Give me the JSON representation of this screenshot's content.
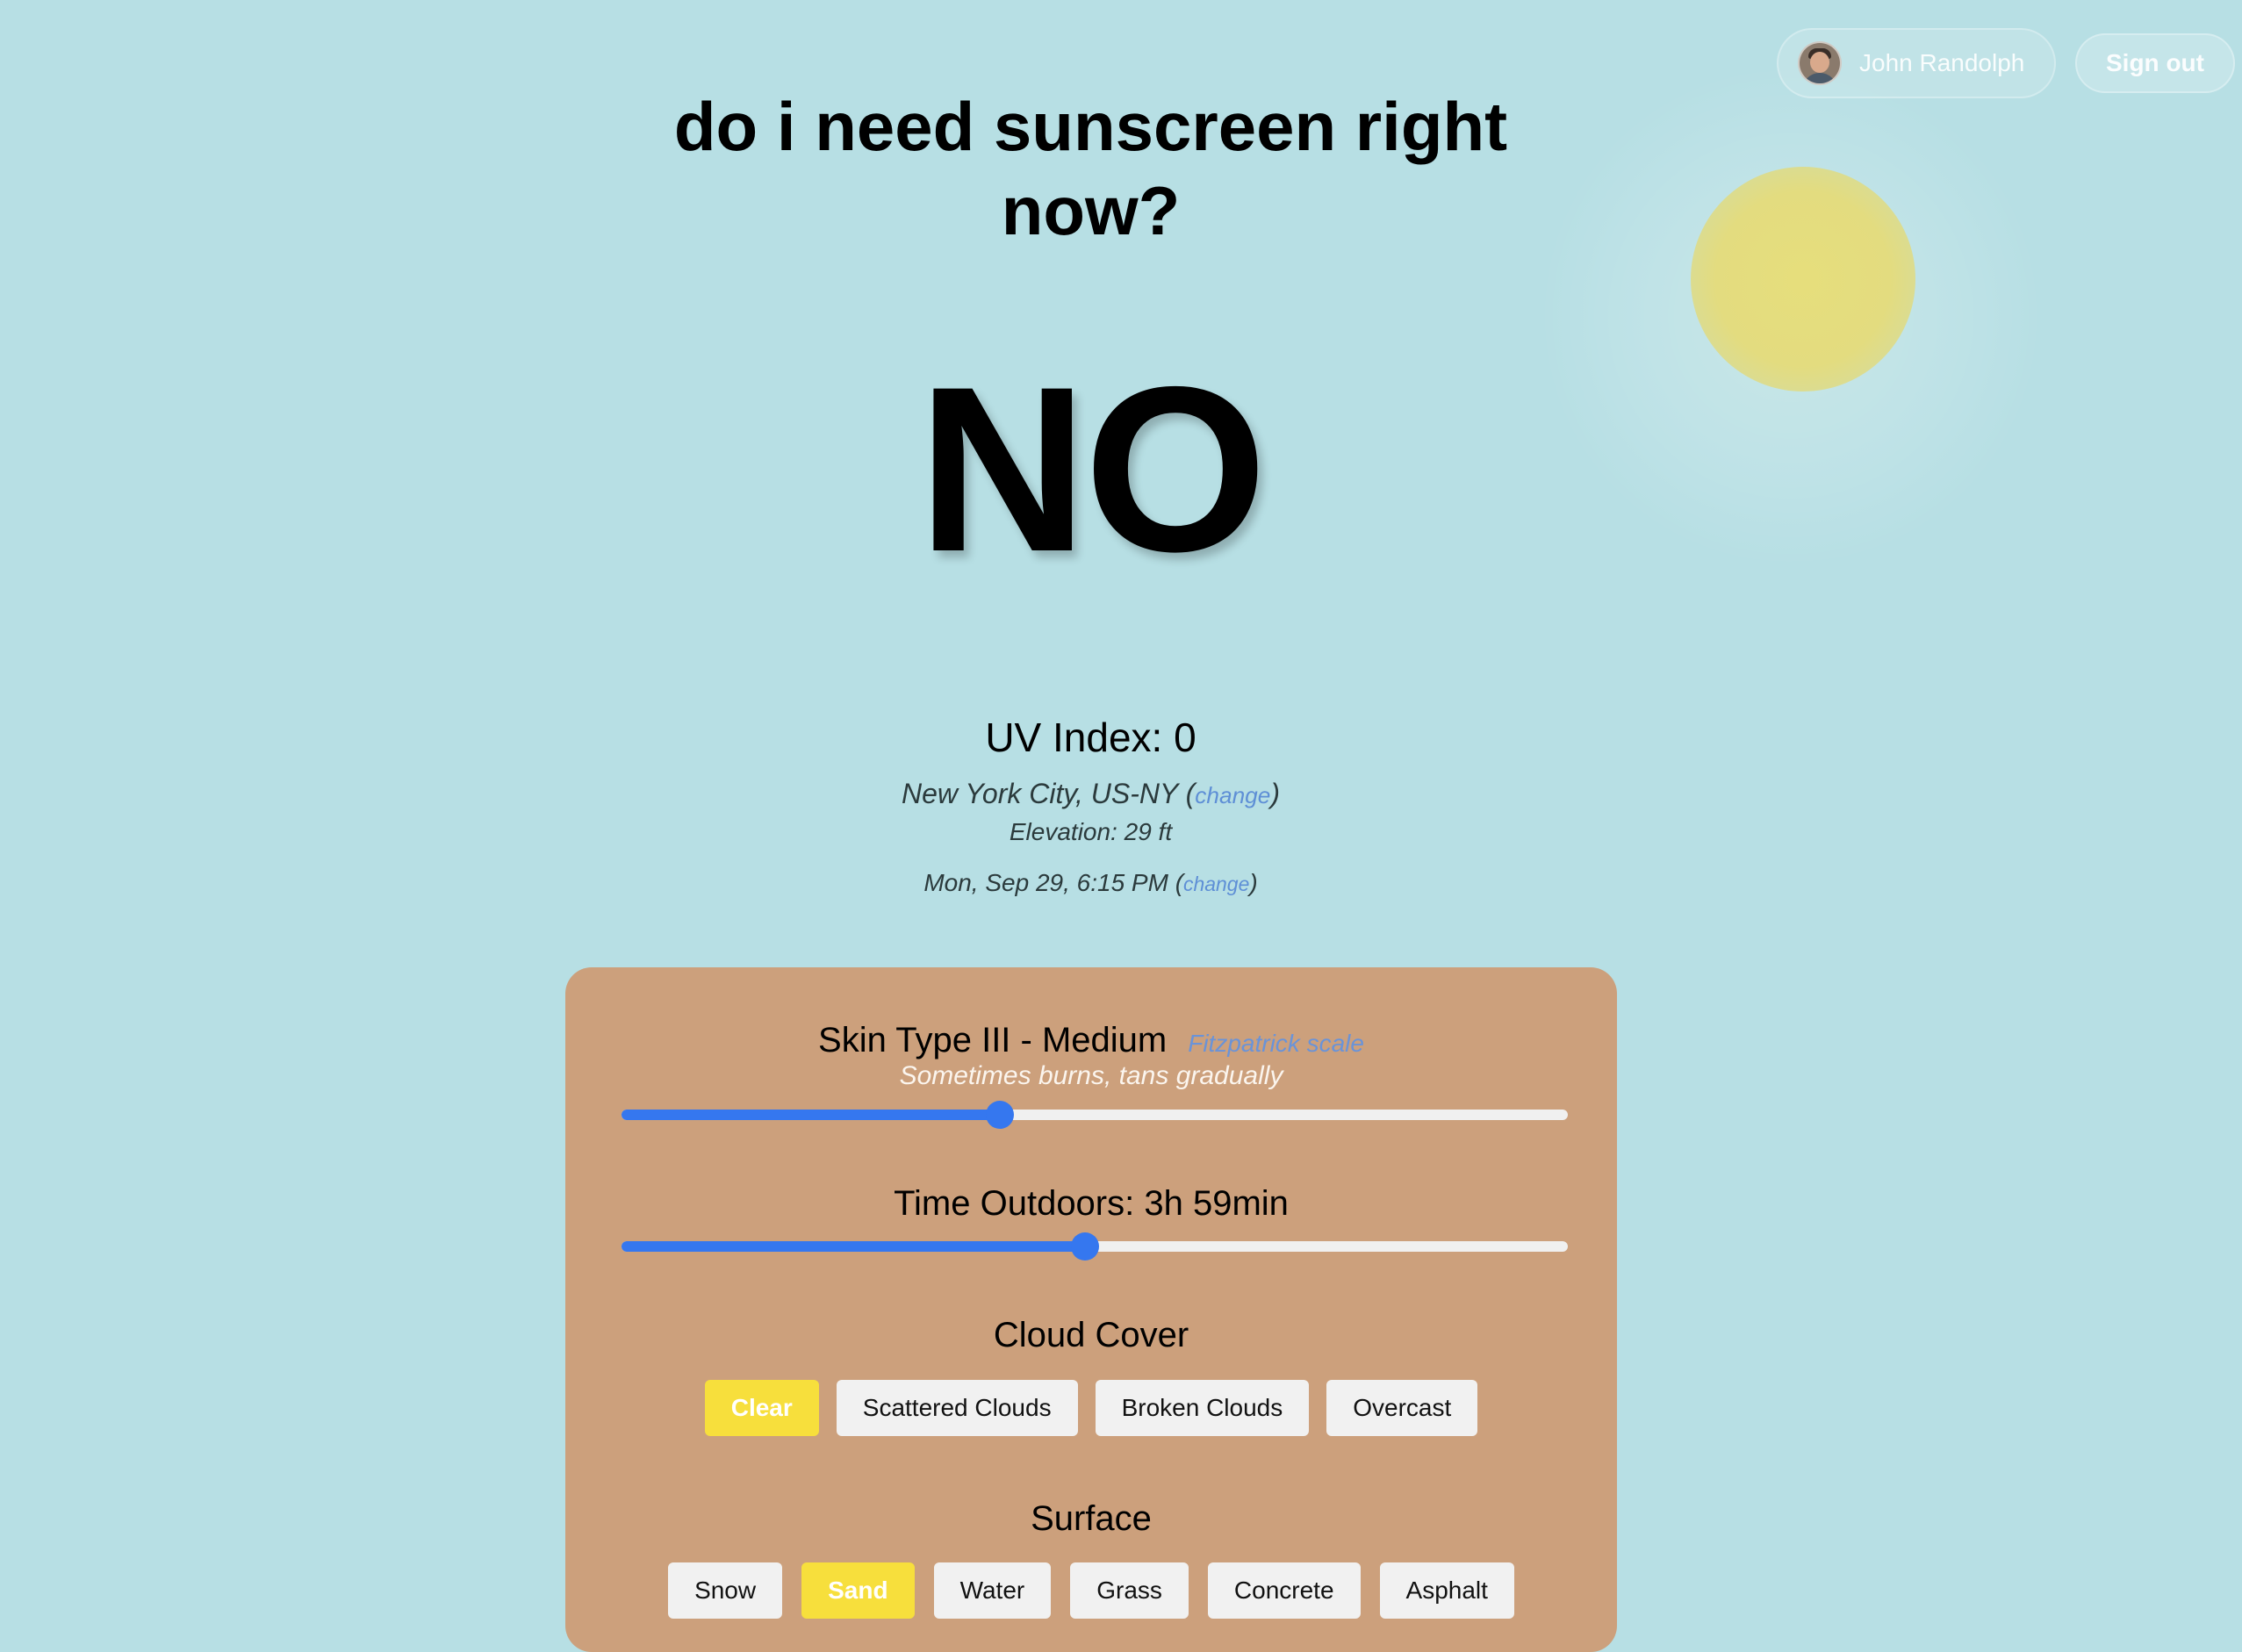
{
  "header": {
    "user_name": "John Randolph",
    "signout_label": "Sign out"
  },
  "title": "do i need sunscreen right now?",
  "answer": "NO",
  "uv": {
    "label": "UV Index: 0",
    "location": "New York City, US-NY",
    "location_change": "change",
    "elevation": "Elevation: 29 ft",
    "datetime": "Mon, Sep 29, 6:15 PM",
    "datetime_change": "change"
  },
  "skin": {
    "title": "Skin Type III - Medium",
    "scale_link": "Fitzpatrick scale",
    "description": "Sometimes burns, tans gradually",
    "slider_fraction": 0.4
  },
  "time": {
    "label": "Time Outdoors: 3h 59min",
    "slider_fraction": 0.49
  },
  "cloud": {
    "label": "Cloud Cover",
    "options": [
      "Clear",
      "Scattered Clouds",
      "Broken Clouds",
      "Overcast"
    ],
    "selected": "Clear"
  },
  "surface": {
    "label": "Surface",
    "options": [
      "Snow",
      "Sand",
      "Water",
      "Grass",
      "Concrete",
      "Asphalt"
    ],
    "selected": "Sand"
  },
  "colors": {
    "background": "#b7dfe4",
    "card": "#cca07c",
    "accent_blue": "#3577ef",
    "active_yellow": "#f7df3c",
    "link_blue": "#5e8fd6"
  }
}
